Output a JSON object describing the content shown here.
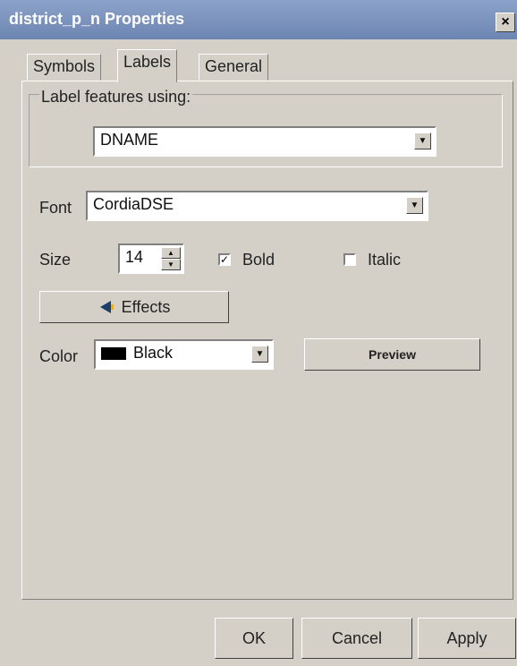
{
  "window": {
    "title": "district_p_n Properties",
    "close_symbol": "×"
  },
  "tabs": [
    {
      "label": "Symbols",
      "active": false
    },
    {
      "label": "Labels",
      "active": true
    },
    {
      "label": "General",
      "active": false
    }
  ],
  "label_group": {
    "title": "Label features using:",
    "field_value": "DNAME"
  },
  "font": {
    "label": "Font",
    "value": "CordiaDSE"
  },
  "size": {
    "label": "Size",
    "value": "14"
  },
  "bold": {
    "label": "Bold",
    "checked": true
  },
  "italic": {
    "label": "Italic",
    "checked": false
  },
  "effects": {
    "label": "Effects"
  },
  "color": {
    "label": "Color",
    "value": "Black",
    "swatch": "#000000"
  },
  "preview": {
    "label": "Preview"
  },
  "footer": {
    "ok": "OK",
    "cancel": "Cancel",
    "apply": "Apply"
  },
  "icons": {
    "dropdown": "chevron-down-icon",
    "effects": "megaphone-icon"
  },
  "checkmark": "✓"
}
